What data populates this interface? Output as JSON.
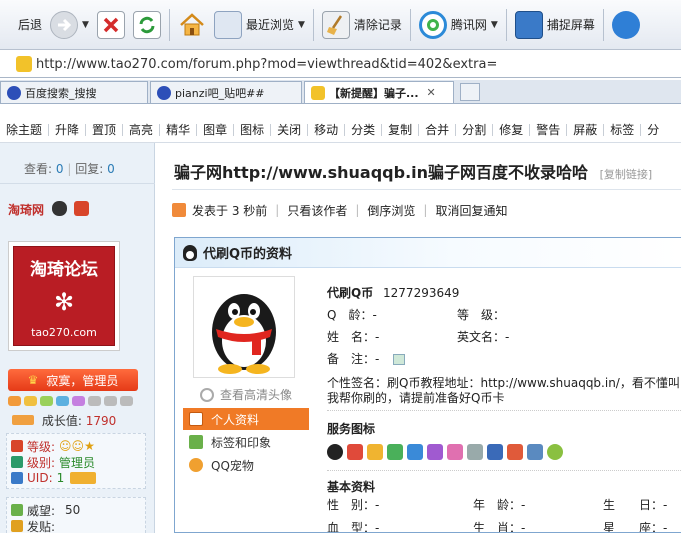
{
  "toolbar": {
    "back_label": "后退",
    "recent_label": "最近浏览",
    "clear_label": "清除记录",
    "tencent_label": "腾讯网",
    "capture_label": "捕捉屏幕"
  },
  "address": {
    "url": "http://www.tao270.com/forum.php?mod=viewthread&tid=402&extra="
  },
  "tabs": [
    {
      "label": "百度搜索_搜搜"
    },
    {
      "label": "pianzi吧_贴吧##"
    },
    {
      "label": "【新提醒】骗子..."
    }
  ],
  "admin_actions": [
    "除主题",
    "升降",
    "置顶",
    "高亮",
    "精华",
    "图章",
    "图标",
    "关闭",
    "移动",
    "分类",
    "复制",
    "合并",
    "分割",
    "修复",
    "警告",
    "屏蔽",
    "标签",
    "分"
  ],
  "sidebar": {
    "views_label": "查看:",
    "views_value": "0",
    "replies_label": "回复:",
    "replies_value": "0",
    "username": "淘琦网",
    "forum_logo": {
      "title": "淘琦论坛",
      "domain": "tao270.com"
    },
    "rank": "寂寞，管理员",
    "growth_label": "成长值:",
    "growth_value": "1790",
    "level_label": "等级:",
    "rank_label": "级别:",
    "rank_value": "管理员",
    "uid_label": "UID:",
    "uid_value": "1",
    "prestige_label": "威望:",
    "prestige_value": "50",
    "posts_label": "发贴:"
  },
  "post": {
    "title": "骗子网http://www.shuaqqb.in骗子网百度不收录哈哈",
    "copy_link": "[复制链接]",
    "posted": "发表于 3 秒前",
    "only_author": "只看该作者",
    "reverse": "倒序浏览",
    "cancel_notify": "取消回复通知"
  },
  "profile": {
    "header": "代刷Q币的资料",
    "hd_avatar": "查看高清头像",
    "menu": [
      "个人资料",
      "标签和印象",
      "QQ宠物"
    ],
    "qq_name": "代刷Q币",
    "qq_number": "1277293649",
    "age_label": "Q　龄：",
    "age_value": "-",
    "grade_label": "等　级：",
    "name_label": "姓　名：",
    "name_value": "-",
    "english_label": "英文名：",
    "english_value": "-",
    "note_label": "备　注：",
    "note_value": "-",
    "sign_label": "个性签名：",
    "sign_value": "刷Q币教程地址：http://www.shuaqqb.in/，看不懂叫我帮你刷的，请提前准备好Q币卡",
    "services_title": "服务图标",
    "basic_title": "基本资料",
    "basic": [
      {
        "label": "性　别：",
        "value": "-"
      },
      {
        "label": "年　龄：",
        "value": "-"
      },
      {
        "label": "生　　日：",
        "value": "-"
      },
      {
        "label": "血　型：",
        "value": "-"
      },
      {
        "label": "生　肖：",
        "value": "-"
      },
      {
        "label": "星　　座：",
        "value": "-"
      }
    ]
  }
}
